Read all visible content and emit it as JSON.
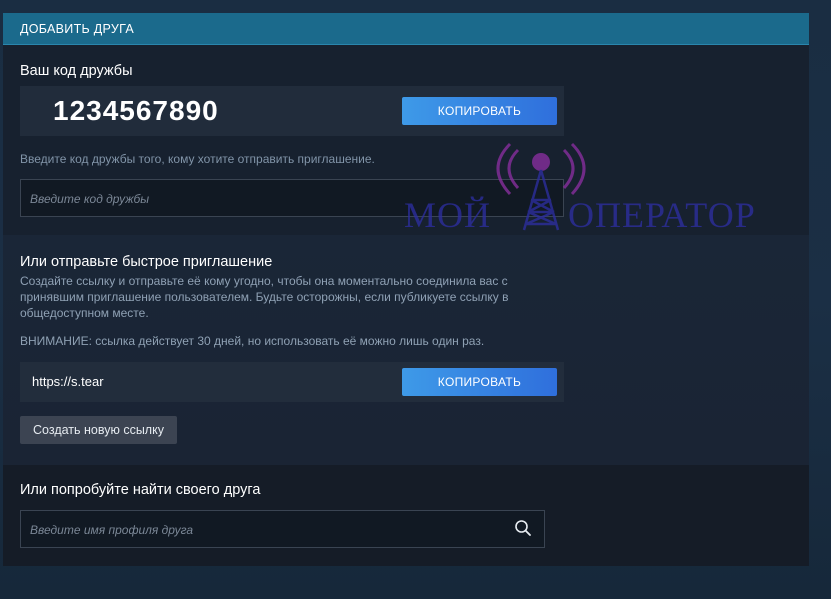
{
  "header": {
    "title": "ДОБАВИТЬ ДРУГА"
  },
  "friend_code": {
    "title": "Ваш код дружбы",
    "value": "1234567890",
    "copy_label": "КОПИРОВАТЬ",
    "hint": "Введите код дружбы того, кому хотите отправить приглашение.",
    "input_placeholder": "Введите код дружбы"
  },
  "quick_invite": {
    "title": "Или отправьте быстрое приглашение",
    "description": "Создайте ссылку и отправьте её кому угодно, чтобы она моментально соединила вас с принявшим приглашение пользователем. Будьте осторожны, если публикуете ссылку в общедоступном месте.",
    "warning": "ВНИМАНИЕ: ссылка действует 30 дней, но использовать её можно лишь один раз.",
    "link_value": "https://s.tear",
    "copy_label": "КОПИРОВАТЬ",
    "new_link_label": "Создать новую ссылку"
  },
  "find_friend": {
    "title": "Или попробуйте найти своего друга",
    "input_placeholder": "Введите имя профиля друга",
    "search_icon": "search-icon"
  },
  "watermark": {
    "text_left": "МОЙ",
    "text_right": "ОПЕРАТОР",
    "color": "#2d2ea0"
  },
  "colors": {
    "header": "#1b6a8c",
    "button_primary": "#3e9ae8",
    "button_secondary": "#3c4452"
  }
}
